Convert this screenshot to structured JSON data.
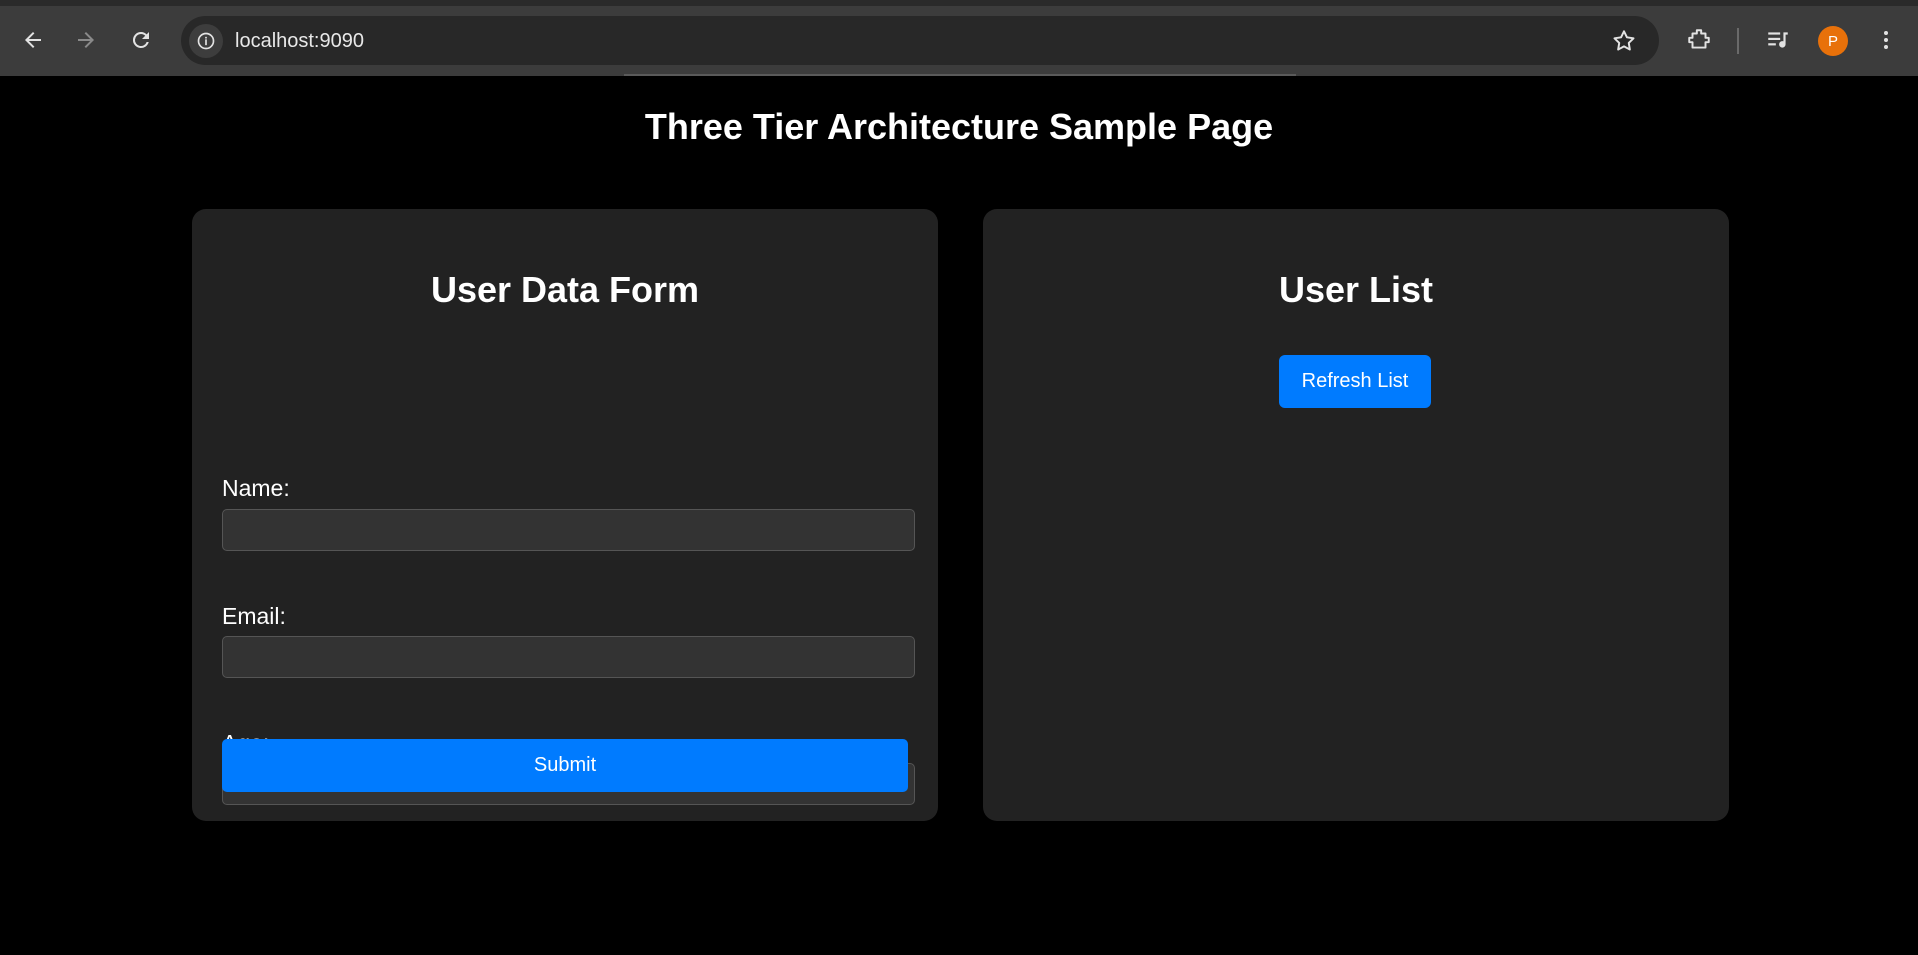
{
  "browser": {
    "url": "localhost:9090",
    "avatar_initial": "P",
    "avatar_color": "#e8710a"
  },
  "page": {
    "title": "Three Tier Architecture Sample Page"
  },
  "form": {
    "title": "User Data Form",
    "fields": [
      {
        "label": "Name:",
        "value": "",
        "placeholder": ""
      },
      {
        "label": "Email:",
        "value": "",
        "placeholder": ""
      },
      {
        "label": "Age:",
        "value": "",
        "placeholder": ""
      }
    ],
    "submit_label": "Submit"
  },
  "user_list": {
    "title": "User List",
    "refresh_label": "Refresh List"
  },
  "colors": {
    "accent": "#007bff",
    "card_bg": "#222222",
    "page_bg": "#000000"
  }
}
